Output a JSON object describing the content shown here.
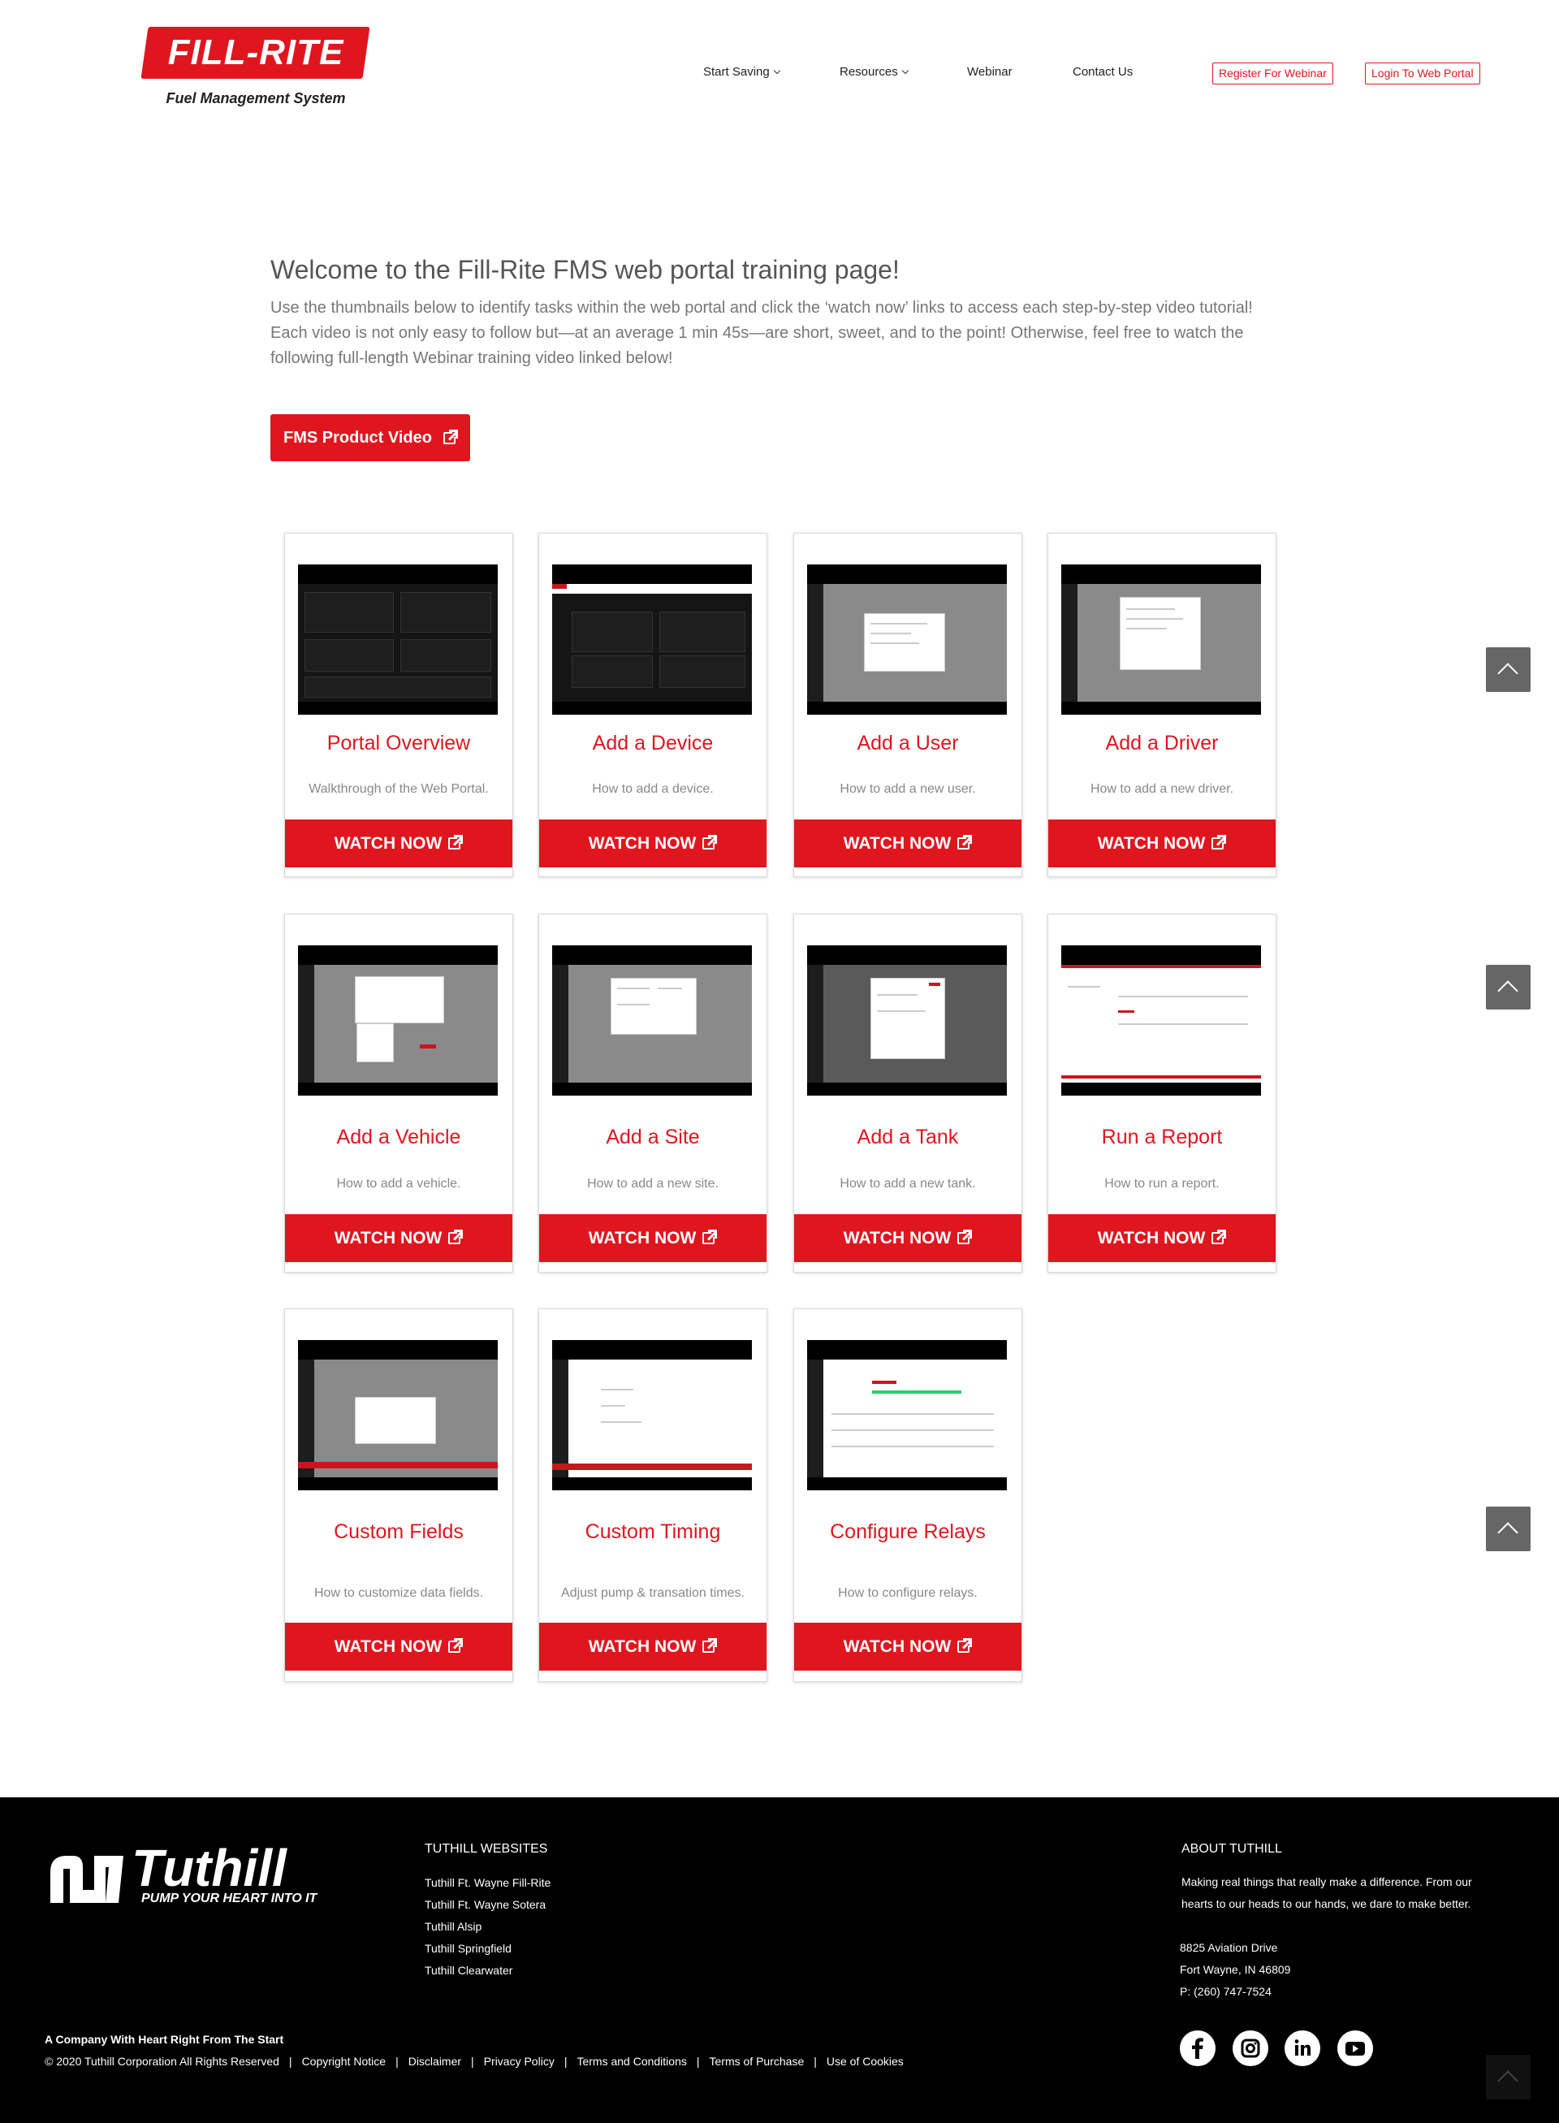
{
  "header": {
    "logo_text": "FILL-RITE",
    "logo_sub": "Fuel Management System",
    "nav": [
      "Start Saving",
      "Resources",
      "Webinar",
      "Contact Us"
    ],
    "register_label": "Register For Webinar",
    "login_label": "Login To Web Portal"
  },
  "intro": {
    "title": "Welcome to the Fill-Rite FMS web portal training page!",
    "text": "Use the thumbnails below to identify tasks within the web portal and click the ‘watch now’ links to access each step-by-step video tutorial! Each video is not only easy to follow but—at an average 1 min 45s—are short, sweet, and to the point! Otherwise, feel free to watch the following full-length Webinar training video linked below!",
    "product_button": "FMS Product Video"
  },
  "cards": [
    {
      "title": "Portal Overview",
      "desc": "Walkthrough of the Web Portal.",
      "button": "WATCH NOW"
    },
    {
      "title": "Add a Device",
      "desc": "How to add a device.",
      "button": "WATCH NOW"
    },
    {
      "title": "Add a User",
      "desc": "How to add a new user.",
      "button": "WATCH NOW"
    },
    {
      "title": "Add a Driver",
      "desc": "How to add a new driver.",
      "button": "WATCH NOW"
    },
    {
      "title": "Add a Vehicle",
      "desc": "How to add a vehicle.",
      "button": "WATCH NOW"
    },
    {
      "title": "Add a Site",
      "desc": "How to add a new site.",
      "button": "WATCH NOW"
    },
    {
      "title": "Add a Tank",
      "desc": "How to add a new tank.",
      "button": "WATCH NOW"
    },
    {
      "title": "Run a Report",
      "desc": "How to run a report.",
      "button": "WATCH NOW"
    },
    {
      "title": "Custom Fields",
      "desc": "How to customize data fields.",
      "button": "WATCH NOW"
    },
    {
      "title": "Custom Timing",
      "desc": "Adjust pump & transation times.",
      "button": "WATCH NOW"
    },
    {
      "title": "Configure Relays",
      "desc": "How to configure relays.",
      "button": "WATCH NOW"
    }
  ],
  "footer": {
    "logo_name": "Tuthill",
    "logo_tag": "PUMP YOUR HEART INTO IT",
    "websites_heading": "TUTHILL WEBSITES",
    "websites": [
      "Tuthill Ft. Wayne Fill-Rite",
      "Tuthill Ft. Wayne Sotera",
      "Tuthill Alsip",
      "Tuthill Springfield",
      "Tuthill Clearwater"
    ],
    "about_heading": "ABOUT TUTHILL",
    "about_text_1": "Making real things that really make a difference. From our",
    "about_text_2": "hearts to our heads to our hands, we dare to make better.",
    "address_1": "8825 Aviation Drive",
    "address_2": "Fort Wayne, IN 46809",
    "phone": "P: (260) 747-7524",
    "tagline": "A Company With Heart Right From The Start",
    "copyright": "© 2020 Tuthill Corporation All Rights Reserved",
    "legal_links": [
      "Copyright Notice",
      "Disclaimer",
      "Privacy Policy",
      "Terms and Conditions",
      "Terms of Purchase",
      "Use of Cookies"
    ],
    "social": [
      "facebook-icon",
      "instagram-icon",
      "linkedin-icon",
      "youtube-icon"
    ]
  },
  "colors": {
    "brand_red": "#e0161f",
    "footer_bg": "#000000"
  }
}
